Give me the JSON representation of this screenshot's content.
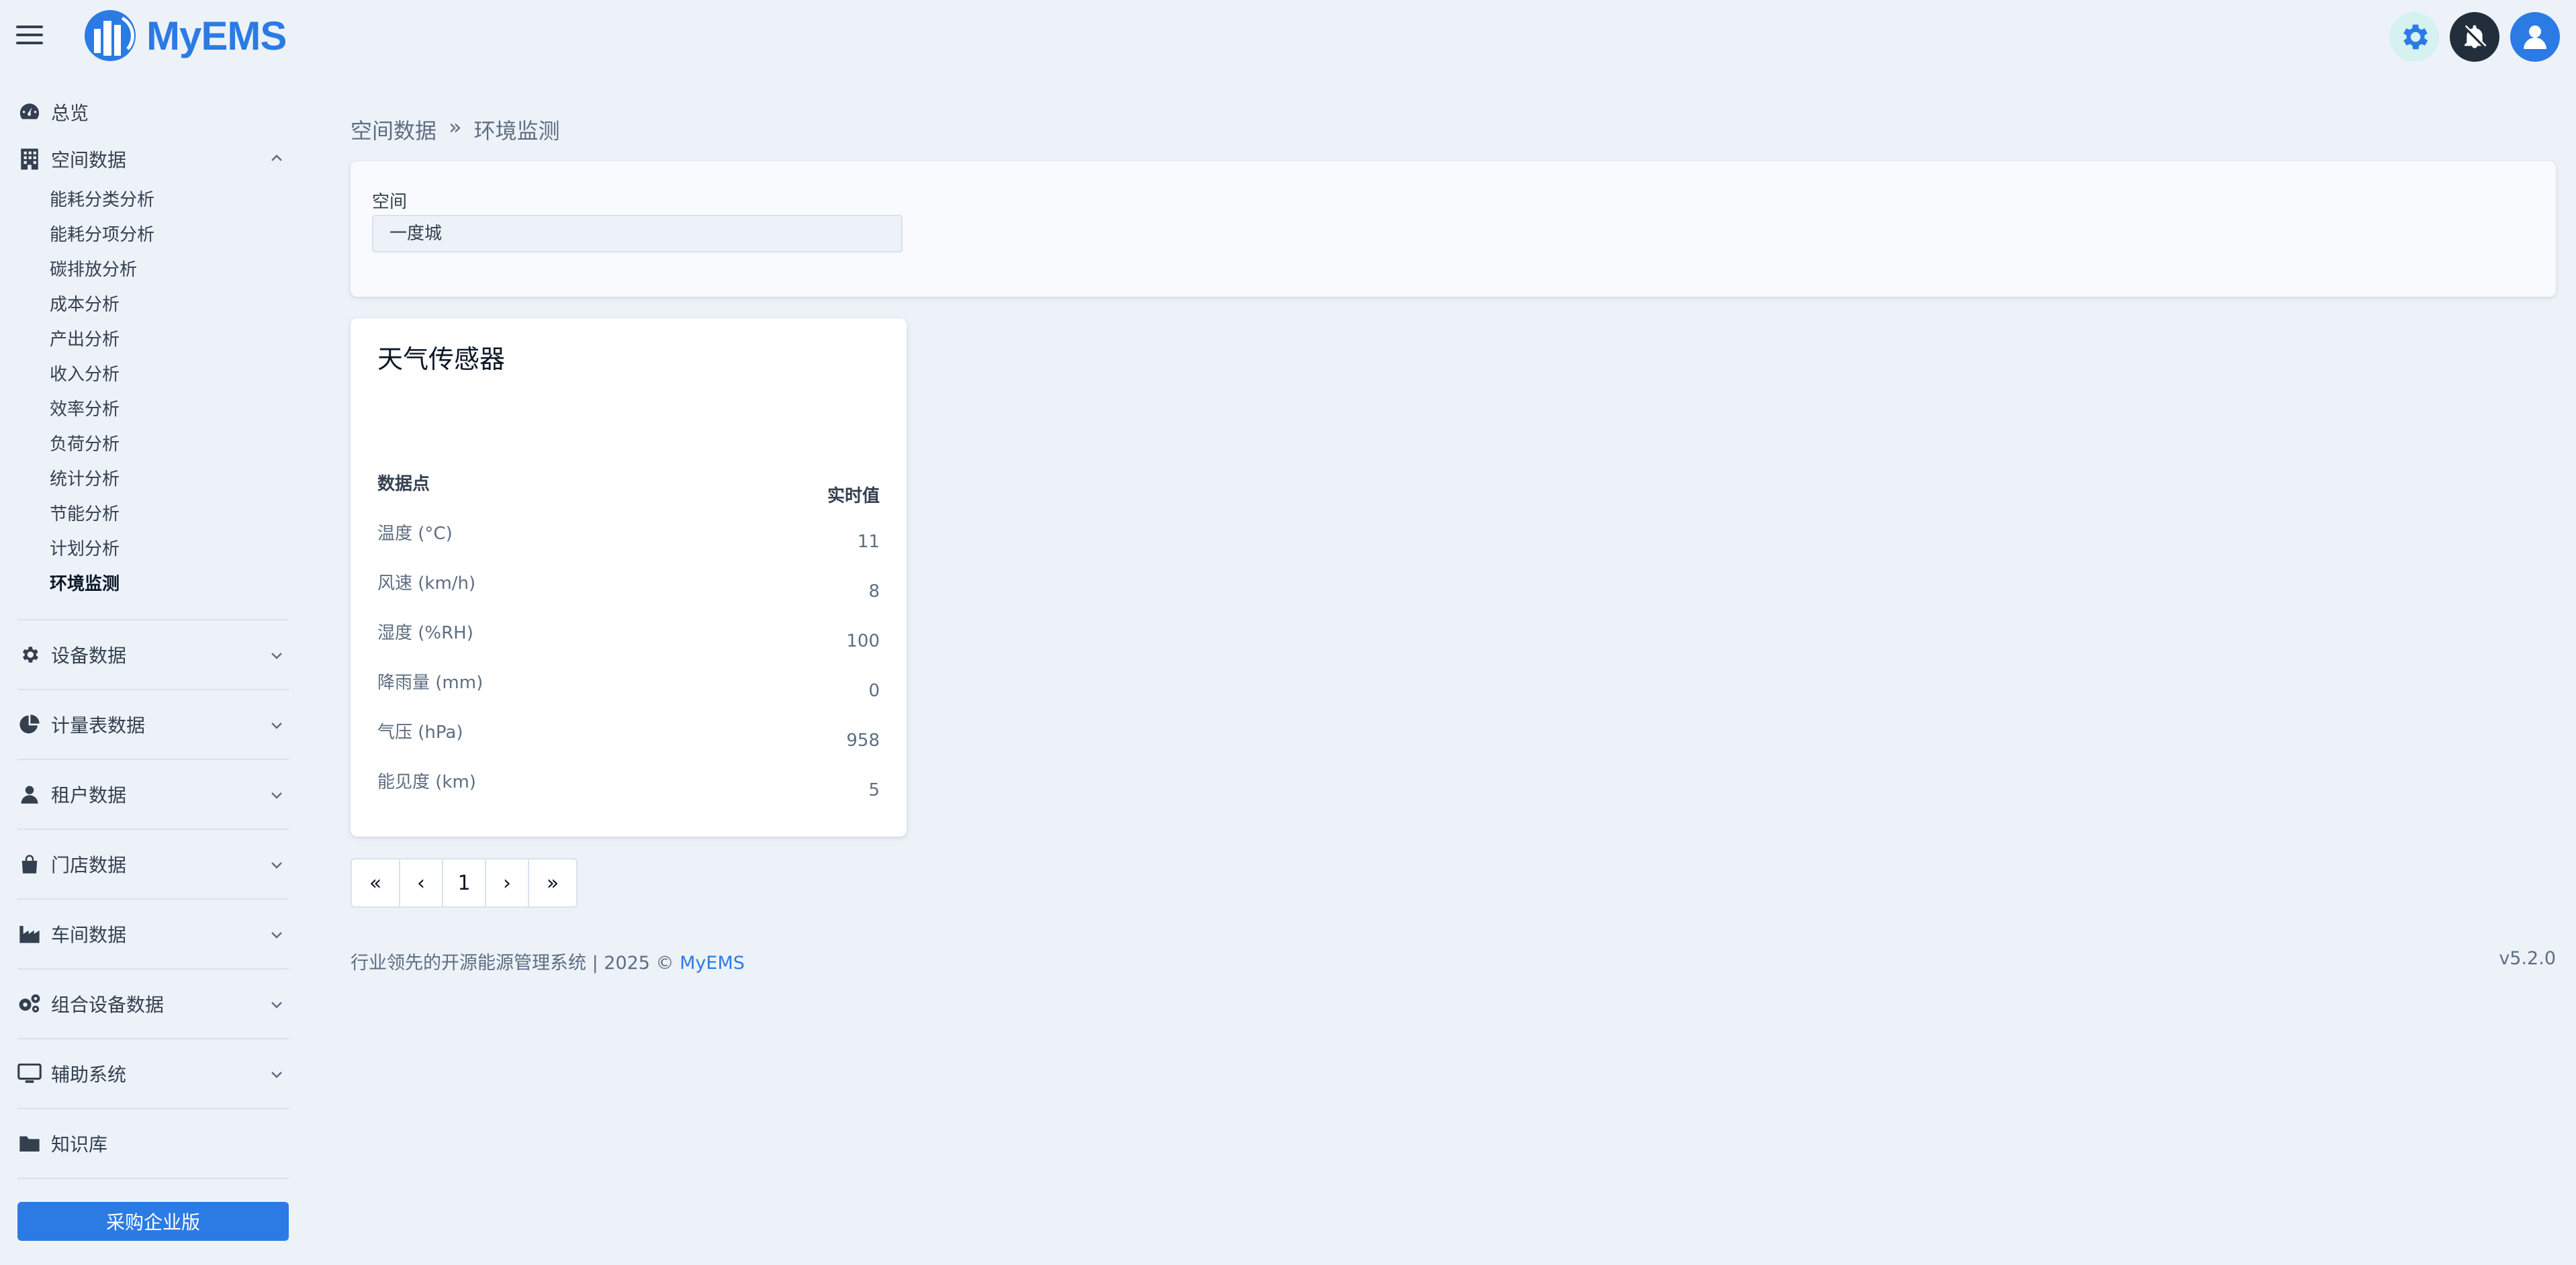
{
  "header": {
    "brand": "MyEMS",
    "brand_color": "#2c7be5"
  },
  "sidebar": {
    "overview": {
      "label": "总览",
      "icon": "dashboard-icon"
    },
    "space": {
      "label": "空间数据",
      "icon": "building-icon",
      "expanded": true,
      "items": [
        {
          "label": "能耗分类分析"
        },
        {
          "label": "能耗分项分析"
        },
        {
          "label": "碳排放分析"
        },
        {
          "label": "成本分析"
        },
        {
          "label": "产出分析"
        },
        {
          "label": "收入分析"
        },
        {
          "label": "效率分析"
        },
        {
          "label": "负荷分析"
        },
        {
          "label": "统计分析"
        },
        {
          "label": "节能分析"
        },
        {
          "label": "计划分析"
        },
        {
          "label": "环境监测",
          "active": true
        }
      ]
    },
    "groups": [
      {
        "label": "设备数据",
        "icon": "gear-icon"
      },
      {
        "label": "计量表数据",
        "icon": "pie-chart-icon"
      },
      {
        "label": "租户数据",
        "icon": "user-icon"
      },
      {
        "label": "门店数据",
        "icon": "shopping-bag-icon"
      },
      {
        "label": "车间数据",
        "icon": "industry-icon"
      },
      {
        "label": "组合设备数据",
        "icon": "cogs-icon"
      },
      {
        "label": "辅助系统",
        "icon": "desktop-icon"
      },
      {
        "label": "知识库",
        "icon": "folder-icon"
      }
    ],
    "buy_button": "采购企业版"
  },
  "breadcrumb": {
    "parent": "空间数据",
    "separator": "»",
    "current": "环境监测"
  },
  "filter": {
    "label": "空间",
    "value": "一度城"
  },
  "sensor": {
    "title": "天气传感器",
    "col_point": "数据点",
    "col_value": "实时值",
    "rows": [
      {
        "name": "温度 (°C)",
        "value": "11"
      },
      {
        "name": "风速 (km/h)",
        "value": "8"
      },
      {
        "name": "湿度 (%RH)",
        "value": "100"
      },
      {
        "name": "降雨量 (mm)",
        "value": "0"
      },
      {
        "name": "气压 (hPa)",
        "value": "958"
      },
      {
        "name": "能见度 (km)",
        "value": "5"
      }
    ]
  },
  "pagination": {
    "first": "«",
    "prev": "‹",
    "page": "1",
    "next": "›",
    "last": "»"
  },
  "footer": {
    "text": "行业领先的开源能源管理系统 | 2025 © ",
    "link": "MyEMS",
    "version": "v5.2.0"
  }
}
